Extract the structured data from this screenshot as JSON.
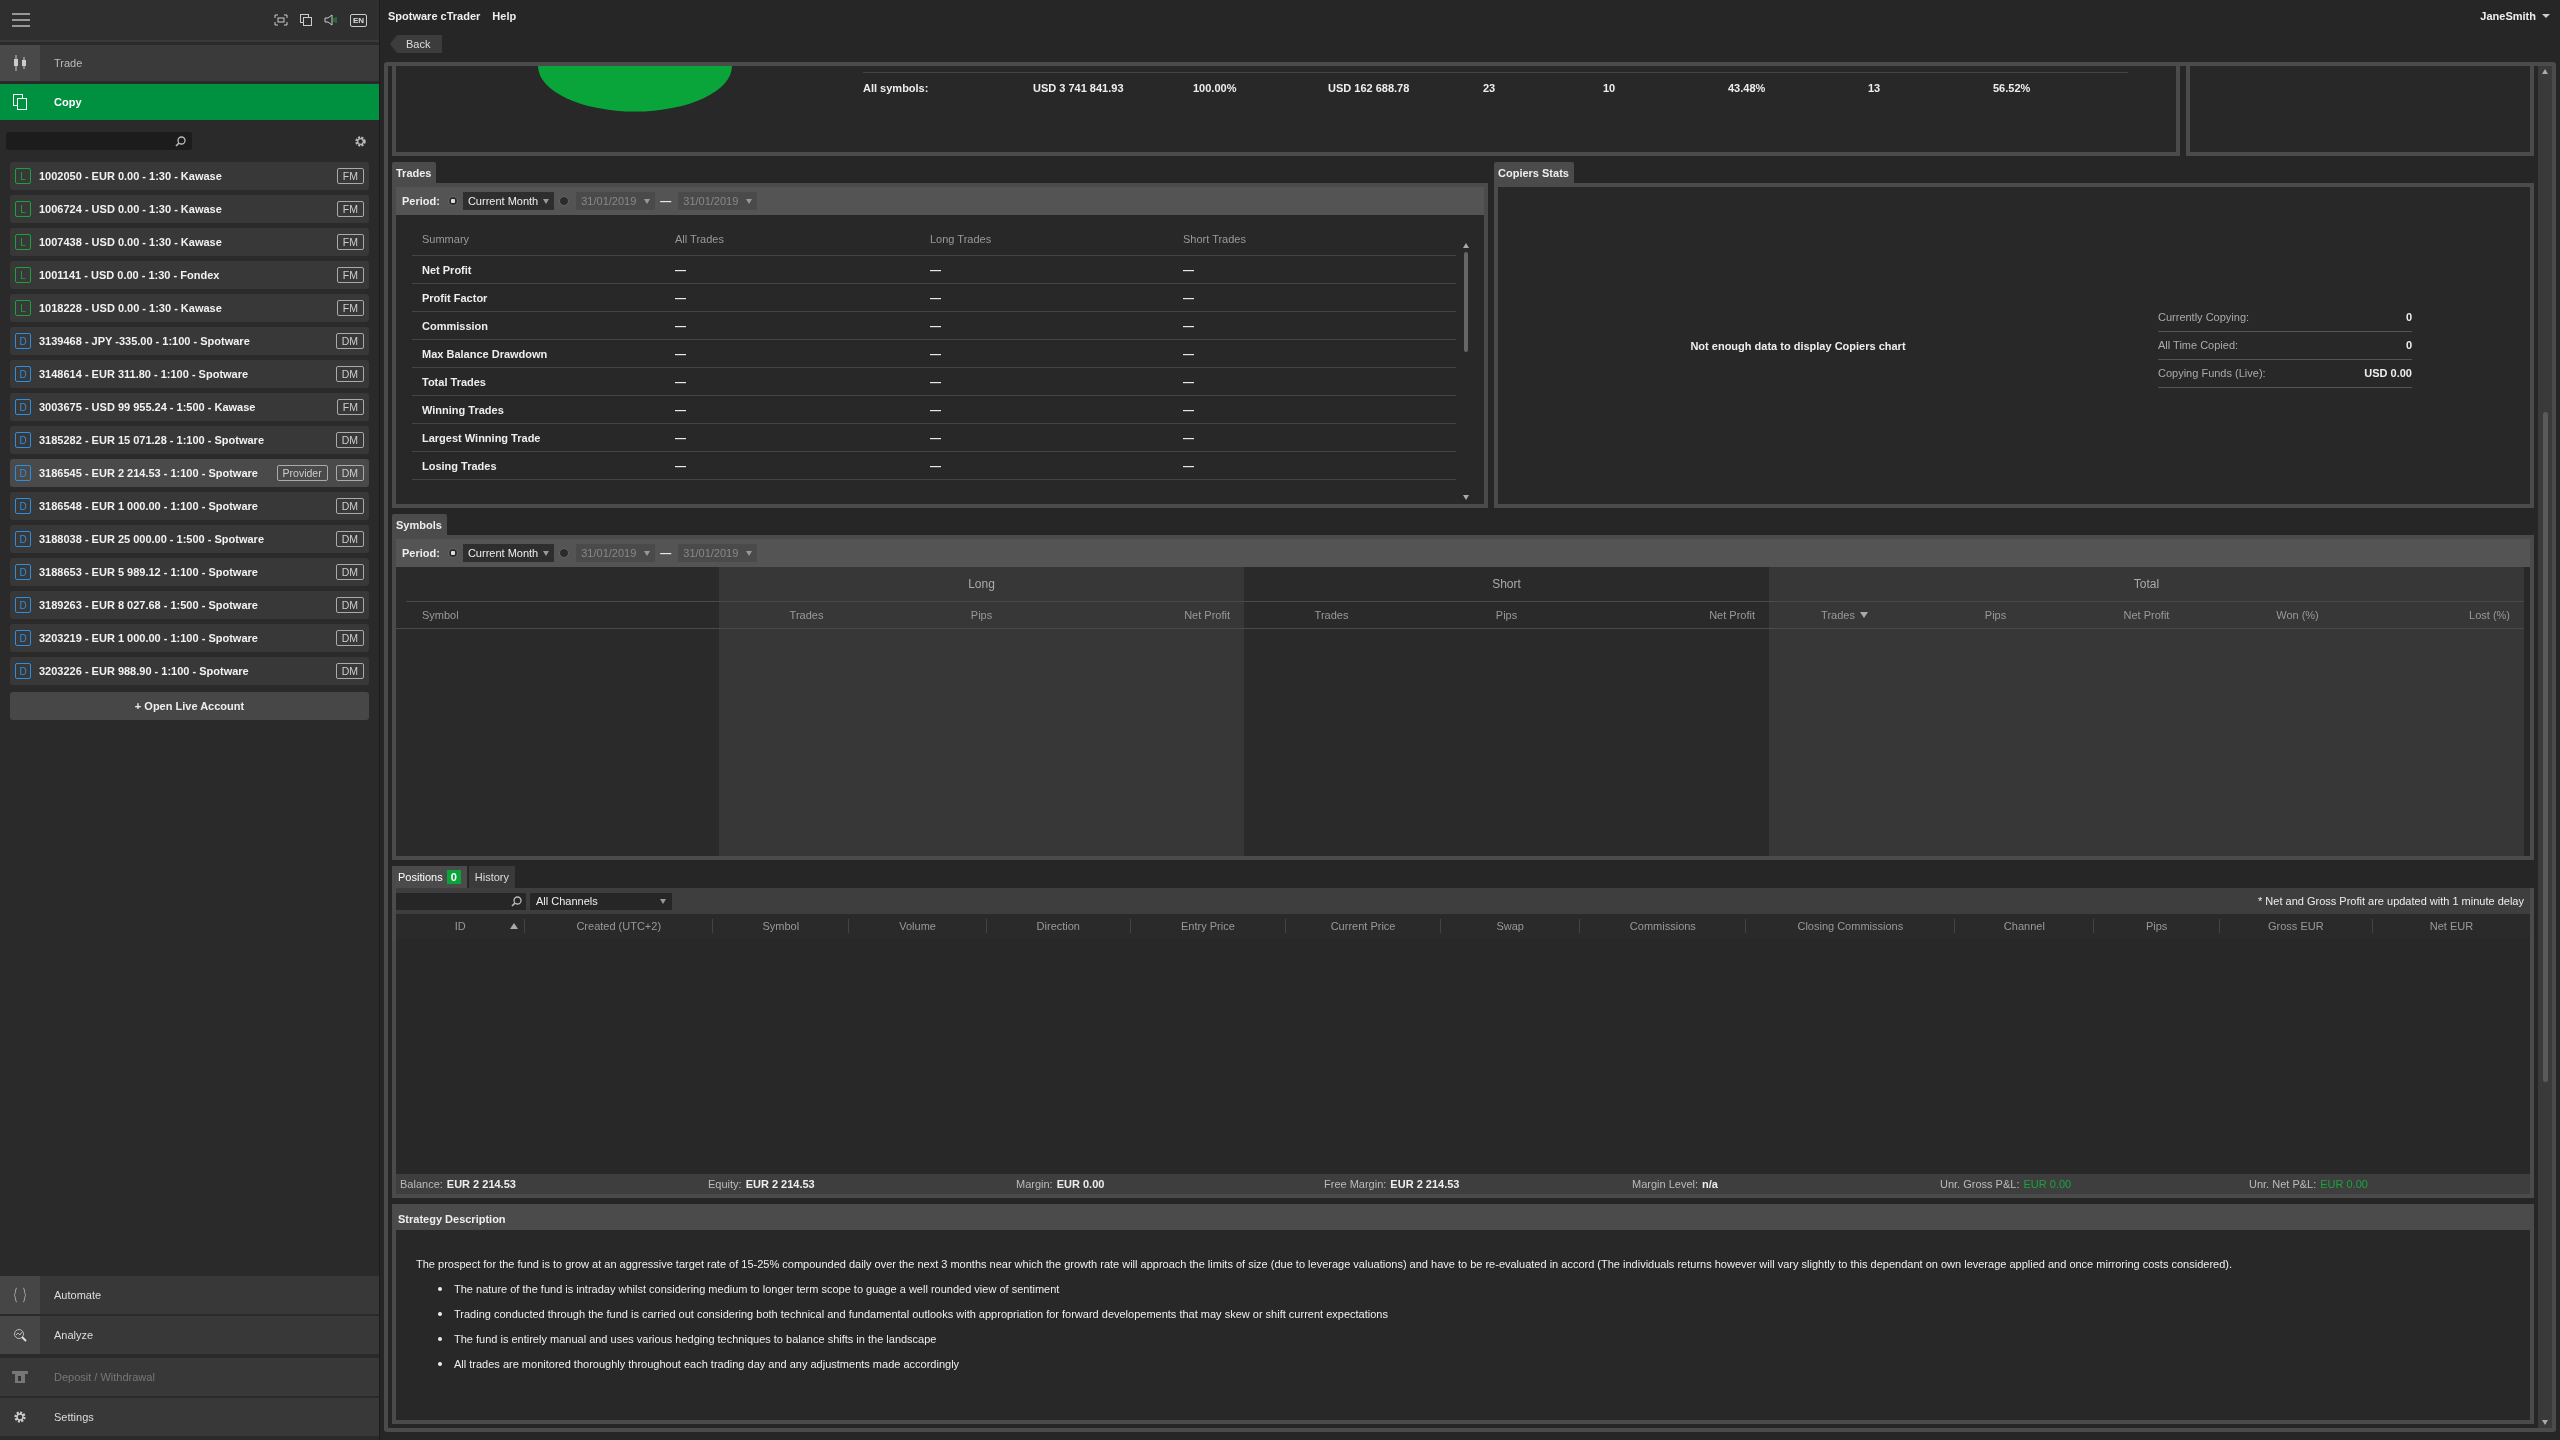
{
  "header": {
    "language": "EN"
  },
  "menu": [
    "Spotware cTrader",
    "Help"
  ],
  "user": "JaneSmith",
  "sidebar": {
    "nav": [
      {
        "label": "Trade",
        "selected": false,
        "kind": "trade"
      },
      {
        "label": "Copy",
        "selected": true,
        "kind": "copy"
      }
    ],
    "accounts": [
      {
        "letter": "L",
        "kind": "live",
        "label": "1002050 - EUR 0.00 - 1:30 - Kawase",
        "tags": [
          "FM"
        ],
        "selected": false
      },
      {
        "letter": "L",
        "kind": "live",
        "label": "1006724 - USD 0.00 - 1:30 - Kawase",
        "tags": [
          "FM"
        ],
        "selected": false
      },
      {
        "letter": "L",
        "kind": "live",
        "label": "1007438 - USD 0.00 - 1:30 - Kawase",
        "tags": [
          "FM"
        ],
        "selected": false
      },
      {
        "letter": "L",
        "kind": "live",
        "label": "1001141 - USD 0.00 - 1:30 - Fondex",
        "tags": [
          "FM"
        ],
        "selected": false
      },
      {
        "letter": "L",
        "kind": "live",
        "label": "1018228 - USD 0.00 - 1:30 - Kawase",
        "tags": [
          "FM"
        ],
        "selected": false
      },
      {
        "letter": "D",
        "kind": "demo",
        "label": "3139468 - JPY -335.00 - 1:100 - Spotware",
        "tags": [
          "DM"
        ],
        "selected": false
      },
      {
        "letter": "D",
        "kind": "demo",
        "label": "3148614 - EUR 311.80 - 1:100 - Spotware",
        "tags": [
          "DM"
        ],
        "selected": false
      },
      {
        "letter": "D",
        "kind": "demo",
        "label": "3003675 - USD 99 955.24 - 1:500 - Kawase",
        "tags": [
          "FM"
        ],
        "selected": false
      },
      {
        "letter": "D",
        "kind": "demo",
        "label": "3185282 - EUR 15 071.28 - 1:100 - Spotware",
        "tags": [
          "DM"
        ],
        "selected": false
      },
      {
        "letter": "D",
        "kind": "demo",
        "label": "3186545 - EUR 2 214.53 - 1:100 - Spotware",
        "tags": [
          "Provider",
          "DM"
        ],
        "selected": true
      },
      {
        "letter": "D",
        "kind": "demo",
        "label": "3186548 - EUR 1 000.00 - 1:100 - Spotware",
        "tags": [
          "DM"
        ],
        "selected": false
      },
      {
        "letter": "D",
        "kind": "demo",
        "label": "3188038 - EUR 25 000.00 - 1:500 - Spotware",
        "tags": [
          "DM"
        ],
        "selected": false
      },
      {
        "letter": "D",
        "kind": "demo",
        "label": "3188653 - EUR 5 989.12 - 1:100 - Spotware",
        "tags": [
          "DM"
        ],
        "selected": false
      },
      {
        "letter": "D",
        "kind": "demo",
        "label": "3189263 - EUR 8 027.68 - 1:500 - Spotware",
        "tags": [
          "DM"
        ],
        "selected": false
      },
      {
        "letter": "D",
        "kind": "demo",
        "label": "3203219 - EUR 1 000.00 - 1:100 - Spotware",
        "tags": [
          "DM"
        ],
        "selected": false
      },
      {
        "letter": "D",
        "kind": "demo",
        "label": "3203226 - EUR 988.90 - 1:100 - Spotware",
        "tags": [
          "DM"
        ],
        "selected": false
      }
    ],
    "open_account": "+ Open Live Account",
    "bottom_nav": [
      {
        "label": "Automate",
        "kind": "automate",
        "disabled": false
      },
      {
        "label": "Analyze",
        "kind": "analyze",
        "disabled": false
      },
      {
        "label": "Deposit / Withdrawal",
        "kind": "deposit",
        "disabled": true
      },
      {
        "label": "Settings",
        "kind": "settings",
        "disabled": false
      }
    ]
  },
  "back": "Back",
  "summary": {
    "label": "All symbols:",
    "values": [
      "USD 3 741 841.93",
      "100.00%",
      "USD 162 688.78",
      "23",
      "10",
      "43.48%",
      "13",
      "56.52%"
    ]
  },
  "trades": {
    "tab": "Trades",
    "period_label": "Period:",
    "period": "Current Month",
    "current_month_selected": true,
    "date_from": "31/01/2019",
    "range_sep": "—",
    "date_to": "31/01/2019",
    "columns": [
      "Summary",
      "All Trades",
      "Long Trades",
      "Short Trades"
    ],
    "rows": [
      {
        "label": "Net Profit",
        "values": [
          "—",
          "—",
          "—"
        ]
      },
      {
        "label": "Profit Factor",
        "values": [
          "—",
          "—",
          "—"
        ]
      },
      {
        "label": "Commission",
        "values": [
          "—",
          "—",
          "—"
        ]
      },
      {
        "label": "Max Balance Drawdown",
        "values": [
          "—",
          "—",
          "—"
        ]
      },
      {
        "label": "Total Trades",
        "values": [
          "—",
          "—",
          "—"
        ]
      },
      {
        "label": "Winning Trades",
        "values": [
          "—",
          "—",
          "—"
        ]
      },
      {
        "label": "Largest Winning Trade",
        "values": [
          "—",
          "—",
          "—"
        ]
      },
      {
        "label": "Losing Trades",
        "values": [
          "—",
          "—",
          "—"
        ]
      }
    ]
  },
  "copiers": {
    "tab": "Copiers Stats",
    "message": "Not enough data to display Copiers chart",
    "stats": [
      {
        "label": "Currently Copying:",
        "value": "0"
      },
      {
        "label": "All Time Copied:",
        "value": "0"
      },
      {
        "label": "Copying Funds (Live):",
        "value": "USD 0.00"
      }
    ]
  },
  "symbols": {
    "tab": "Symbols",
    "period_label": "Period:",
    "period": "Current Month",
    "current_month_selected": true,
    "date_from": "31/01/2019",
    "range_sep": "—",
    "date_to": "31/01/2019",
    "first_column": "Symbol",
    "groups": [
      {
        "title": "Long",
        "columns": [
          {
            "label": "Trades",
            "sorted_ascending": false,
            "sorted_descending": false
          },
          {
            "label": "Pips",
            "sorted_ascending": false,
            "sorted_descending": false
          },
          {
            "label": "Net Profit",
            "sorted_ascending": false,
            "sorted_descending": false
          }
        ]
      },
      {
        "title": "Short",
        "columns": [
          {
            "label": "Trades",
            "sorted_ascending": false,
            "sorted_descending": false
          },
          {
            "label": "Pips",
            "sorted_ascending": false,
            "sorted_descending": false
          },
          {
            "label": "Net Profit",
            "sorted_ascending": false,
            "sorted_descending": false
          }
        ]
      },
      {
        "title": "Total",
        "columns": [
          {
            "label": "Trades",
            "sorted_ascending": false,
            "sorted_descending": true
          },
          {
            "label": "Pips",
            "sorted_ascending": false,
            "sorted_descending": false
          },
          {
            "label": "Net Profit",
            "sorted_ascending": false,
            "sorted_descending": false
          },
          {
            "label": "Won (%)",
            "sorted_ascending": false,
            "sorted_descending": false
          },
          {
            "label": "Lost (%)",
            "sorted_ascending": false,
            "sorted_descending": false
          }
        ]
      }
    ]
  },
  "positions": {
    "tabs": [
      {
        "label": "Positions",
        "count": "0",
        "selected": true
      },
      {
        "label": "History",
        "selected": false
      }
    ],
    "channel": "All Channels",
    "note": "* Net and Gross Profit are updated with 1 minute delay",
    "columns": [
      {
        "label": "ID",
        "sorted_ascending": true,
        "sorted_descending": false
      },
      {
        "label": "Created (UTC+2)",
        "sorted_ascending": false,
        "sorted_descending": false
      },
      {
        "label": "Symbol",
        "sorted_ascending": false,
        "sorted_descending": false
      },
      {
        "label": "Volume",
        "sorted_ascending": false,
        "sorted_descending": false
      },
      {
        "label": "Direction",
        "sorted_ascending": false,
        "sorted_descending": false
      },
      {
        "label": "Entry Price",
        "sorted_ascending": false,
        "sorted_descending": false
      },
      {
        "label": "Current Price",
        "sorted_ascending": false,
        "sorted_descending": false
      },
      {
        "label": "Swap",
        "sorted_ascending": false,
        "sorted_descending": false
      },
      {
        "label": "Commissions",
        "sorted_ascending": false,
        "sorted_descending": false
      },
      {
        "label": "Closing Commissions",
        "sorted_ascending": false,
        "sorted_descending": false
      },
      {
        "label": "Channel",
        "sorted_ascending": false,
        "sorted_descending": false
      },
      {
        "label": "Pips",
        "sorted_ascending": false,
        "sorted_descending": false
      },
      {
        "label": "Gross EUR",
        "sorted_ascending": false,
        "sorted_descending": false
      },
      {
        "label": "Net EUR",
        "sorted_ascending": false,
        "sorted_descending": false
      }
    ]
  },
  "account_bar": [
    {
      "label": "Balance:",
      "value": "EUR 2 214.53",
      "kind": "plain"
    },
    {
      "label": "Equity:",
      "value": "EUR 2 214.53",
      "kind": "plain"
    },
    {
      "label": "Margin:",
      "value": "EUR 0.00",
      "kind": "plain"
    },
    {
      "label": "Free Margin:",
      "value": "EUR 2 214.53",
      "kind": "plain"
    },
    {
      "label": "Margin Level:",
      "value": "n/a",
      "kind": "plain"
    },
    {
      "label": "Unr. Gross P&L:",
      "value": "EUR 0.00",
      "kind": "pnl"
    },
    {
      "label": "Unr. Net P&L:",
      "value": "EUR 0.00",
      "kind": "pnl"
    }
  ],
  "strategy": {
    "title": "Strategy Description",
    "intro": "The prospect for the fund is to grow at an aggressive target rate of 15-25% compounded daily over the next 3 months near which the growth rate will approach the limits of size (due to leverage valuations) and have to be re-evaluated in accord (The individuals returns however will vary slightly to this dependant on own leverage applied and once mirroring costs considered).",
    "bullets": [
      "The nature of the fund is intraday whilst considering medium to longer term scope to guage a well rounded view of sentiment",
      "Trading conducted through the fund is carried out considering both technical and fundamental outlooks with appropriation for forward developements that may skew or shift current expectations",
      "The fund is entirely manual and uses various hedging techniques to balance shifts in the landscape",
      "All trades are monitored thoroughly throughout each trading day and any adjustments made accordingly"
    ]
  }
}
